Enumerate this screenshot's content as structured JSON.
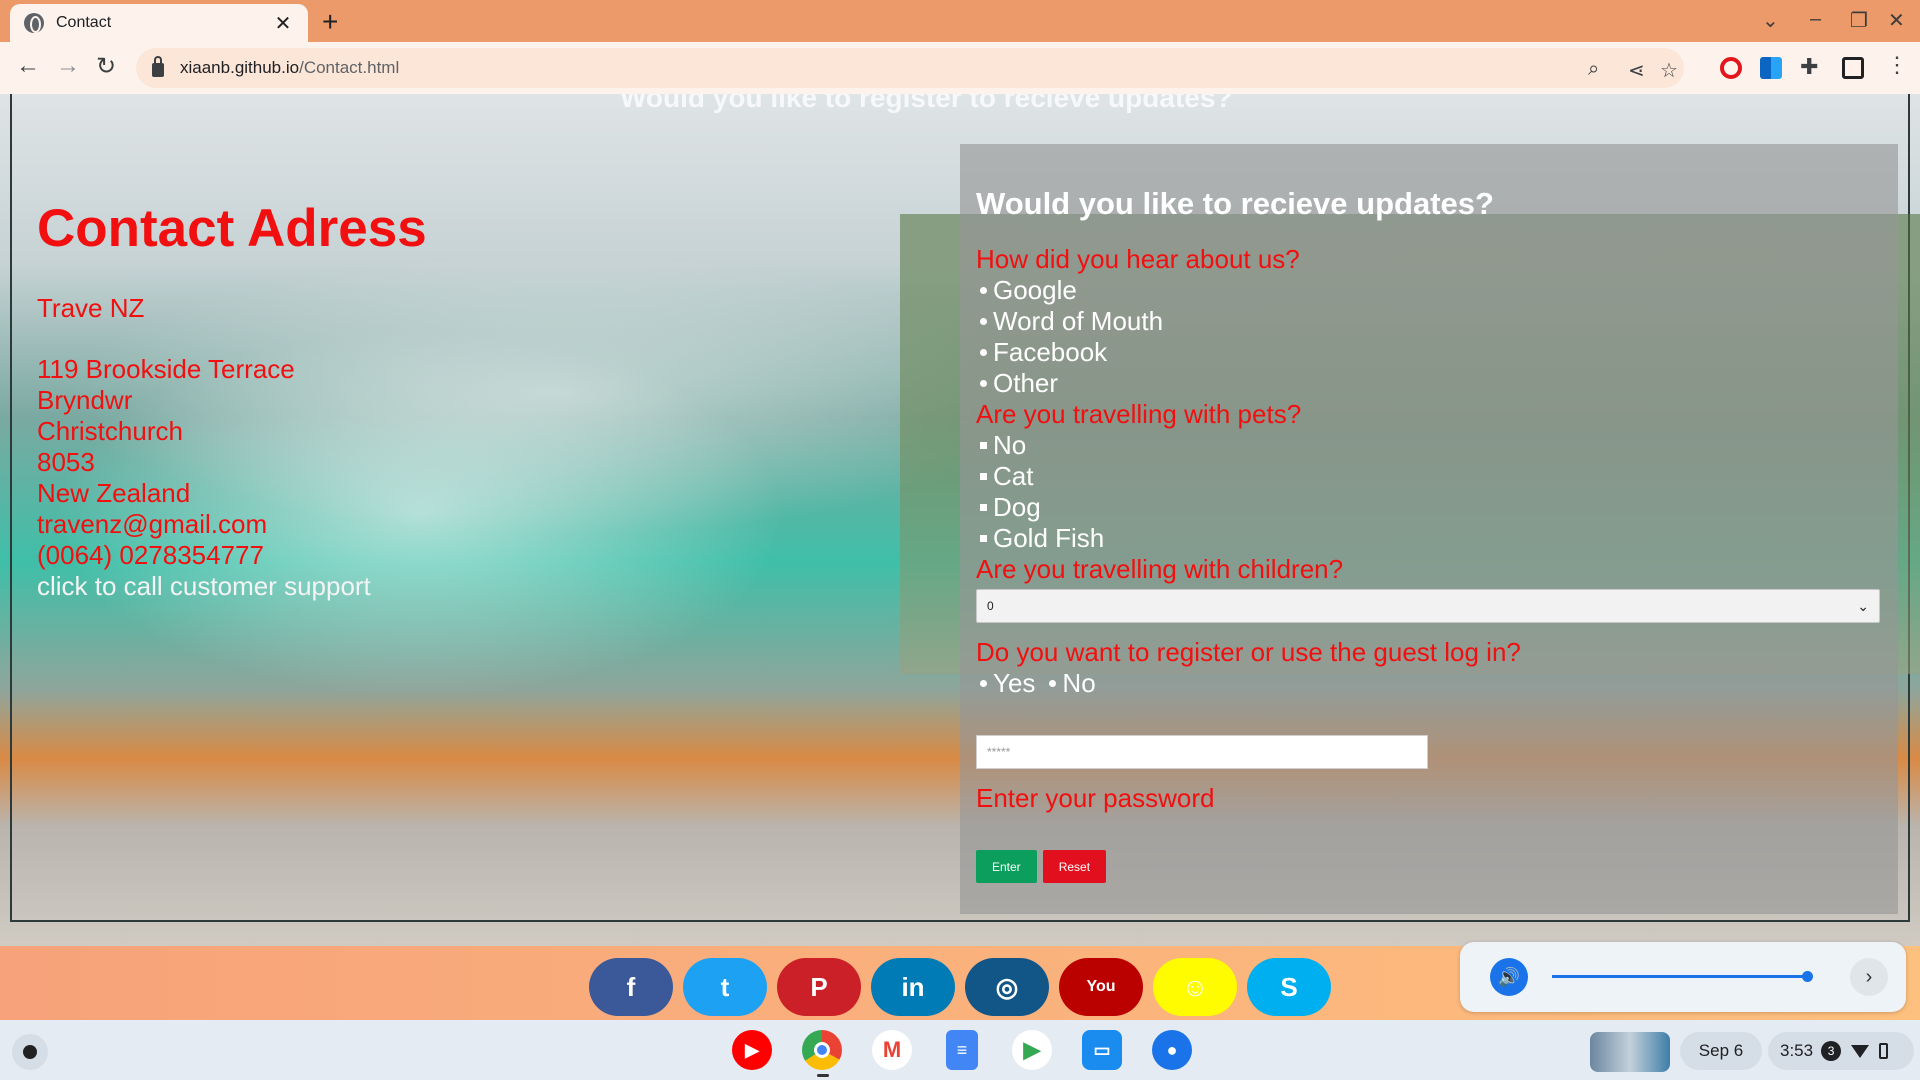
{
  "browser": {
    "tab_title": "Contact",
    "tab_close": "✕",
    "new_tab": "+",
    "url_host": "xiaanb.github.io",
    "url_path": "/Contact.html"
  },
  "page": {
    "ghost_title": "Would you like to register to recieve updates?",
    "contact": {
      "title": "Contact Adress",
      "company": "Trave NZ",
      "address_lines": [
        "119 Brookside Terrace",
        "Bryndwr",
        "Christchurch",
        "8053",
        "New Zealand"
      ],
      "email": "travenz@gmail.com",
      "phone": "(0064) 0278354777",
      "call_link": "click to call customer support"
    },
    "form": {
      "title": "Would you like to recieve updates?",
      "q_hear": "How did you hear about us?",
      "hear_options": [
        "Google",
        "Word of Mouth",
        "Facebook",
        "Other"
      ],
      "q_pets": "Are you travelling with pets?",
      "pet_options": [
        "No",
        "Cat",
        "Dog",
        "Gold Fish"
      ],
      "q_children": "Are you travelling with children?",
      "children_value": "0",
      "q_register": "Do you want to register or use the guest log in?",
      "register_options": [
        "Yes",
        "No"
      ],
      "password_value": "*****",
      "password_label": "Enter your password",
      "enter_label": "Enter",
      "reset_label": "Reset"
    }
  },
  "social": [
    {
      "name": "facebook",
      "glyph": "f",
      "color": "#3b5998"
    },
    {
      "name": "twitter",
      "glyph": "t",
      "color": "#1da1f2"
    },
    {
      "name": "pinterest",
      "glyph": "P",
      "color": "#cb2027"
    },
    {
      "name": "linkedin",
      "glyph": "in",
      "color": "#007bb5"
    },
    {
      "name": "instagram",
      "glyph": "◎",
      "color": "#125688"
    },
    {
      "name": "youtube",
      "glyph": "You",
      "color": "#bb0000"
    },
    {
      "name": "snapchat",
      "glyph": "☺",
      "color": "#fffc00"
    },
    {
      "name": "skype",
      "glyph": "S",
      "color": "#00aff0"
    }
  ],
  "media": {
    "volume_fraction": 0.98
  },
  "shelf": {
    "date": "Sep 6",
    "time": "3:53",
    "notification_count": "3"
  }
}
